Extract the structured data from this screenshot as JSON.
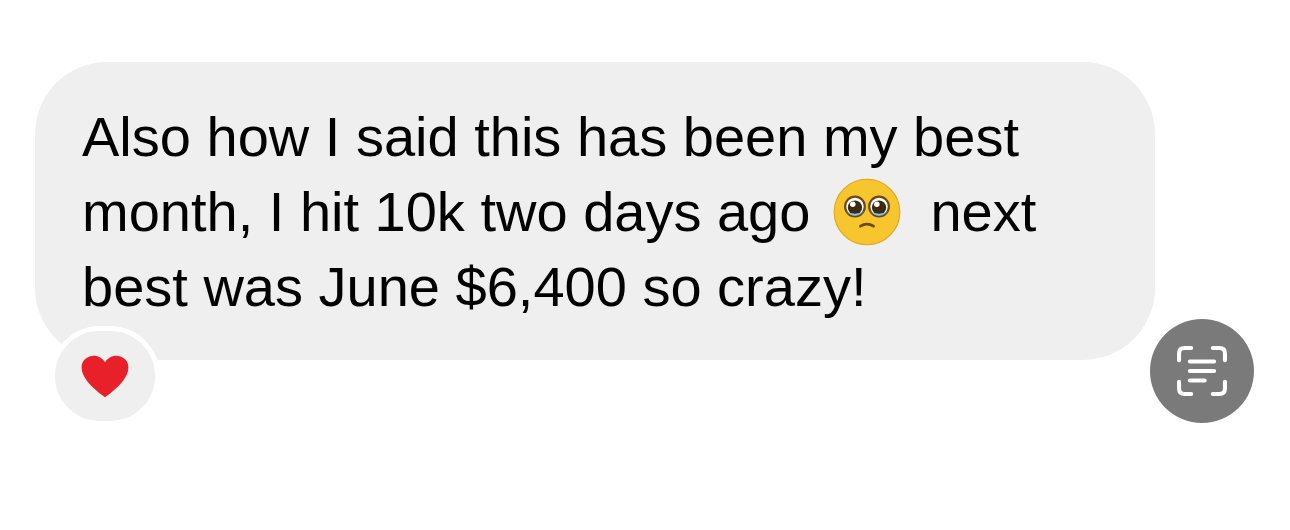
{
  "message": {
    "lines": [
      {
        "segments": [
          {
            "kind": "text",
            "text": "Also how I said this has been my best"
          }
        ]
      },
      {
        "segments": [
          {
            "kind": "text",
            "text": "month, I hit 10k two days ago"
          },
          {
            "kind": "emoji"
          },
          {
            "kind": "text",
            "text": "next"
          }
        ]
      },
      {
        "segments": [
          {
            "kind": "text",
            "text": "best was June $6,400 so crazy!"
          }
        ]
      }
    ],
    "reaction": {
      "kind": "heart"
    }
  }
}
